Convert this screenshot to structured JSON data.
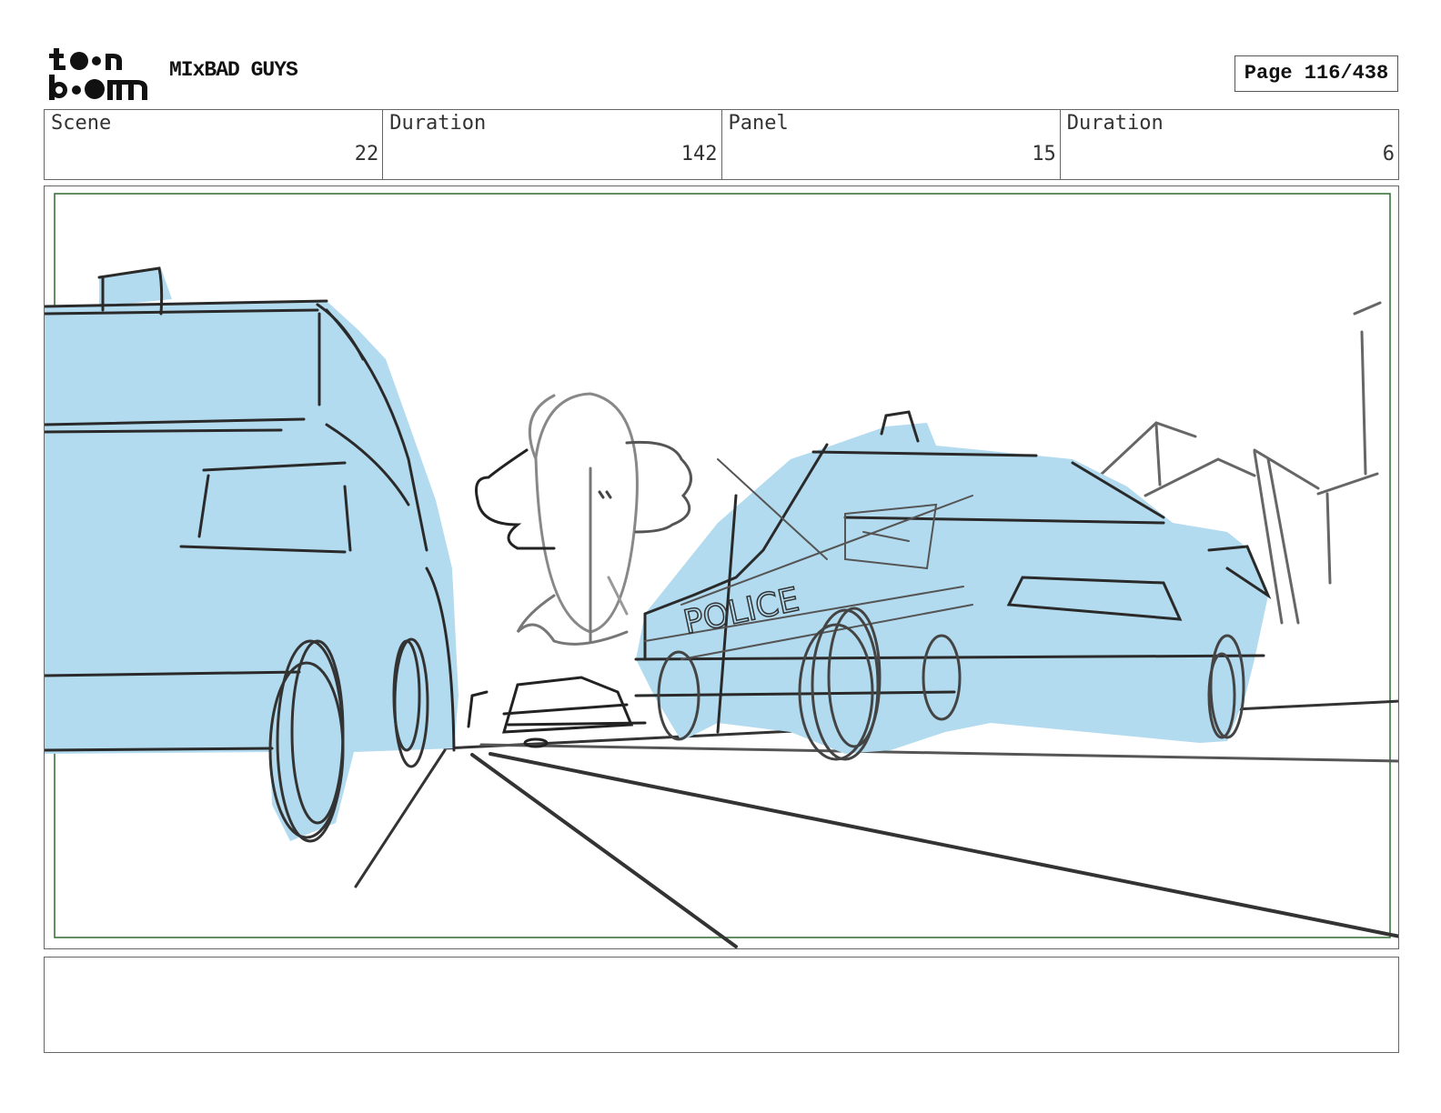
{
  "header": {
    "project_title": "MIxBAD GUYS",
    "page": "Page 116/438"
  },
  "info": {
    "scene_label": "Scene",
    "scene_value": "22",
    "scene_duration_label": "Duration",
    "scene_duration_value": "142",
    "panel_label": "Panel",
    "panel_value": "15",
    "panel_duration_label": "Duration",
    "panel_duration_value": "6"
  },
  "panel": {
    "car_text": "POLICE"
  },
  "colors": {
    "car_fill": "#b3dbef",
    "safe_frame": "#2f6b2f",
    "sketch_line": "#2a2a2a"
  },
  "notes": ""
}
